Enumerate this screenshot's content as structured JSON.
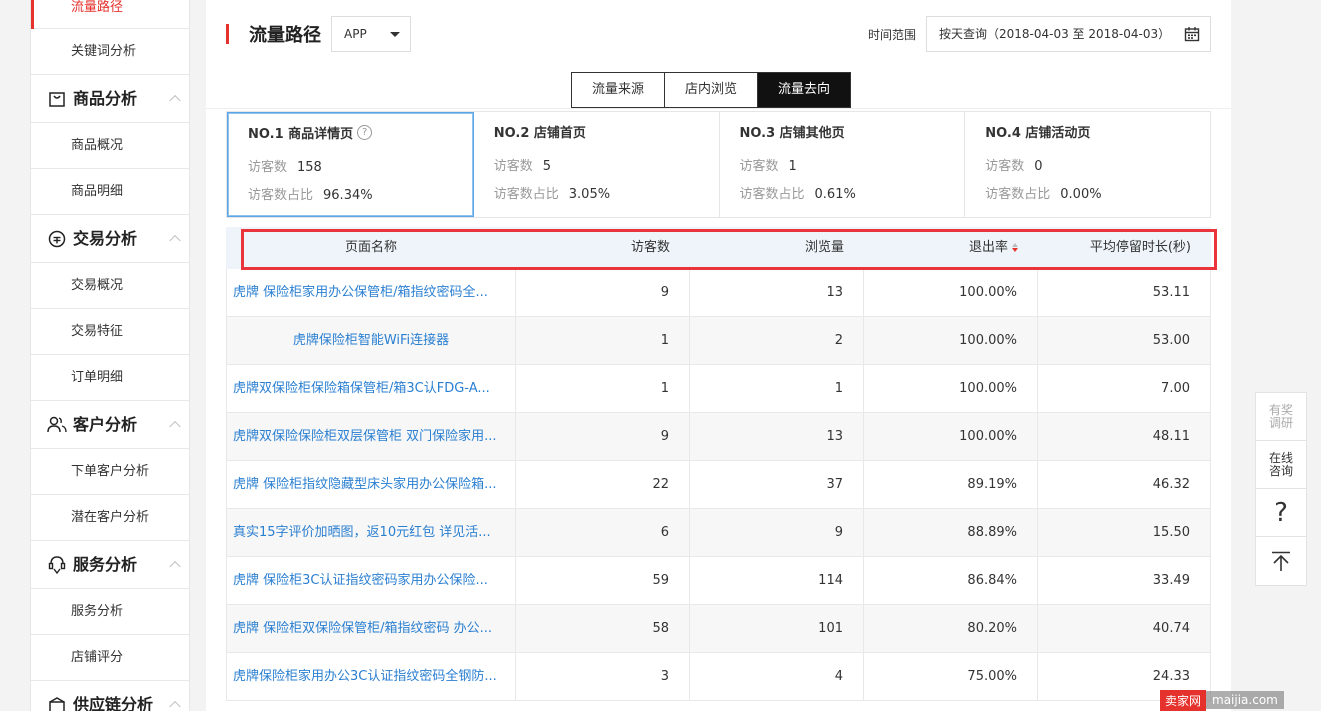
{
  "sidebar": {
    "items": [
      {
        "type": "item",
        "label": "流量路径",
        "active": true
      },
      {
        "type": "item",
        "label": "关键词分析"
      },
      {
        "type": "group",
        "label": "商品分析",
        "icon": "bag-icon"
      },
      {
        "type": "item",
        "label": "商品概况"
      },
      {
        "type": "item",
        "label": "商品明细"
      },
      {
        "type": "group",
        "label": "交易分析",
        "icon": "yen-icon"
      },
      {
        "type": "item",
        "label": "交易概况"
      },
      {
        "type": "item",
        "label": "交易特征"
      },
      {
        "type": "item",
        "label": "订单明细"
      },
      {
        "type": "group",
        "label": "客户分析",
        "icon": "users-icon"
      },
      {
        "type": "item",
        "label": "下单客户分析"
      },
      {
        "type": "item",
        "label": "潜在客户分析"
      },
      {
        "type": "group",
        "label": "服务分析",
        "icon": "service-icon"
      },
      {
        "type": "item",
        "label": "服务分析"
      },
      {
        "type": "item",
        "label": "店铺评分"
      },
      {
        "type": "group",
        "label": "供应链分析",
        "icon": "supply-icon"
      }
    ]
  },
  "header": {
    "title": "流量路径",
    "platform_select": "APP",
    "time_label": "时间范围",
    "date_range": "按天查询（2018-04-03 至 2018-04-03）"
  },
  "tabs": [
    {
      "label": "流量来源",
      "active": false
    },
    {
      "label": "店内浏览",
      "active": false
    },
    {
      "label": "流量去向",
      "active": true
    }
  ],
  "cards": [
    {
      "title": "NO.1 商品详情页",
      "has_help": true,
      "visitors_label": "访客数",
      "visitors": "158",
      "ratio_label": "访客数占比",
      "ratio": "96.34%",
      "selected": true
    },
    {
      "title": "NO.2 店铺首页",
      "has_help": false,
      "visitors_label": "访客数",
      "visitors": "5",
      "ratio_label": "访客数占比",
      "ratio": "3.05%"
    },
    {
      "title": "NO.3 店铺其他页",
      "has_help": false,
      "visitors_label": "访客数",
      "visitors": "1",
      "ratio_label": "访客数占比",
      "ratio": "0.61%"
    },
    {
      "title": "NO.4 店铺活动页",
      "has_help": false,
      "visitors_label": "访客数",
      "visitors": "0",
      "ratio_label": "访客数占比",
      "ratio": "0.00%"
    }
  ],
  "table": {
    "headers": [
      "页面名称",
      "访客数",
      "浏览量",
      "退出率",
      "平均停留时长(秒)"
    ],
    "rows": [
      [
        "虎牌 保险柜家用办公保管柜/箱指纹密码全...",
        "9",
        "13",
        "100.00%",
        "53.11"
      ],
      [
        "虎牌保险柜智能WiFi连接器",
        "1",
        "2",
        "100.00%",
        "53.00"
      ],
      [
        "虎牌双保险柜保险箱保管柜/箱3C认FDG-A...",
        "1",
        "1",
        "100.00%",
        "7.00"
      ],
      [
        "虎牌双保险保险柜双层保管柜 双门保险家用...",
        "9",
        "13",
        "100.00%",
        "48.11"
      ],
      [
        "虎牌 保险柜指纹隐藏型床头家用办公保险箱...",
        "22",
        "37",
        "89.19%",
        "46.32"
      ],
      [
        "真实15字评价加晒图，返10元红包 详见活...",
        "6",
        "9",
        "88.89%",
        "15.50"
      ],
      [
        "虎牌 保险柜3C认证指纹密码家用办公保险...",
        "59",
        "114",
        "86.84%",
        "33.49"
      ],
      [
        "虎牌 保险柜双保险保管柜/箱指纹密码 办公...",
        "58",
        "101",
        "80.20%",
        "40.74"
      ],
      [
        "虎牌保险柜家用办公3C认证指纹密码全钢防...",
        "3",
        "4",
        "75.00%",
        "24.33"
      ]
    ]
  },
  "float_bar": [
    {
      "label": "有奖\n调研",
      "faded": true
    },
    {
      "label": "在线\n咨询"
    },
    {
      "label": "?"
    },
    {
      "label": "top-icon"
    }
  ],
  "watermark": {
    "brand": "卖家网",
    "url": "maijia.com"
  },
  "colors": {
    "accent": "#e5322d",
    "link": "#2a7fd1",
    "selected_border": "#5aa6e6",
    "highlight": "#e8343a"
  }
}
